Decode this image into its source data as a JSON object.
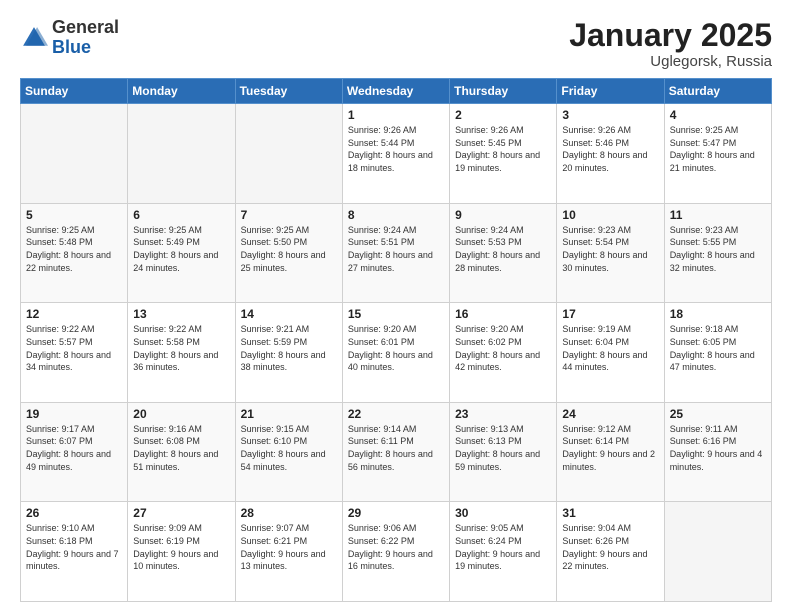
{
  "logo": {
    "general": "General",
    "blue": "Blue"
  },
  "header": {
    "title": "January 2025",
    "subtitle": "Uglegorsk, Russia"
  },
  "weekdays": [
    "Sunday",
    "Monday",
    "Tuesday",
    "Wednesday",
    "Thursday",
    "Friday",
    "Saturday"
  ],
  "weeks": [
    [
      {
        "day": "",
        "detail": ""
      },
      {
        "day": "",
        "detail": ""
      },
      {
        "day": "",
        "detail": ""
      },
      {
        "day": "1",
        "detail": "Sunrise: 9:26 AM\nSunset: 5:44 PM\nDaylight: 8 hours\nand 18 minutes."
      },
      {
        "day": "2",
        "detail": "Sunrise: 9:26 AM\nSunset: 5:45 PM\nDaylight: 8 hours\nand 19 minutes."
      },
      {
        "day": "3",
        "detail": "Sunrise: 9:26 AM\nSunset: 5:46 PM\nDaylight: 8 hours\nand 20 minutes."
      },
      {
        "day": "4",
        "detail": "Sunrise: 9:25 AM\nSunset: 5:47 PM\nDaylight: 8 hours\nand 21 minutes."
      }
    ],
    [
      {
        "day": "5",
        "detail": "Sunrise: 9:25 AM\nSunset: 5:48 PM\nDaylight: 8 hours\nand 22 minutes."
      },
      {
        "day": "6",
        "detail": "Sunrise: 9:25 AM\nSunset: 5:49 PM\nDaylight: 8 hours\nand 24 minutes."
      },
      {
        "day": "7",
        "detail": "Sunrise: 9:25 AM\nSunset: 5:50 PM\nDaylight: 8 hours\nand 25 minutes."
      },
      {
        "day": "8",
        "detail": "Sunrise: 9:24 AM\nSunset: 5:51 PM\nDaylight: 8 hours\nand 27 minutes."
      },
      {
        "day": "9",
        "detail": "Sunrise: 9:24 AM\nSunset: 5:53 PM\nDaylight: 8 hours\nand 28 minutes."
      },
      {
        "day": "10",
        "detail": "Sunrise: 9:23 AM\nSunset: 5:54 PM\nDaylight: 8 hours\nand 30 minutes."
      },
      {
        "day": "11",
        "detail": "Sunrise: 9:23 AM\nSunset: 5:55 PM\nDaylight: 8 hours\nand 32 minutes."
      }
    ],
    [
      {
        "day": "12",
        "detail": "Sunrise: 9:22 AM\nSunset: 5:57 PM\nDaylight: 8 hours\nand 34 minutes."
      },
      {
        "day": "13",
        "detail": "Sunrise: 9:22 AM\nSunset: 5:58 PM\nDaylight: 8 hours\nand 36 minutes."
      },
      {
        "day": "14",
        "detail": "Sunrise: 9:21 AM\nSunset: 5:59 PM\nDaylight: 8 hours\nand 38 minutes."
      },
      {
        "day": "15",
        "detail": "Sunrise: 9:20 AM\nSunset: 6:01 PM\nDaylight: 8 hours\nand 40 minutes."
      },
      {
        "day": "16",
        "detail": "Sunrise: 9:20 AM\nSunset: 6:02 PM\nDaylight: 8 hours\nand 42 minutes."
      },
      {
        "day": "17",
        "detail": "Sunrise: 9:19 AM\nSunset: 6:04 PM\nDaylight: 8 hours\nand 44 minutes."
      },
      {
        "day": "18",
        "detail": "Sunrise: 9:18 AM\nSunset: 6:05 PM\nDaylight: 8 hours\nand 47 minutes."
      }
    ],
    [
      {
        "day": "19",
        "detail": "Sunrise: 9:17 AM\nSunset: 6:07 PM\nDaylight: 8 hours\nand 49 minutes."
      },
      {
        "day": "20",
        "detail": "Sunrise: 9:16 AM\nSunset: 6:08 PM\nDaylight: 8 hours\nand 51 minutes."
      },
      {
        "day": "21",
        "detail": "Sunrise: 9:15 AM\nSunset: 6:10 PM\nDaylight: 8 hours\nand 54 minutes."
      },
      {
        "day": "22",
        "detail": "Sunrise: 9:14 AM\nSunset: 6:11 PM\nDaylight: 8 hours\nand 56 minutes."
      },
      {
        "day": "23",
        "detail": "Sunrise: 9:13 AM\nSunset: 6:13 PM\nDaylight: 8 hours\nand 59 minutes."
      },
      {
        "day": "24",
        "detail": "Sunrise: 9:12 AM\nSunset: 6:14 PM\nDaylight: 9 hours\nand 2 minutes."
      },
      {
        "day": "25",
        "detail": "Sunrise: 9:11 AM\nSunset: 6:16 PM\nDaylight: 9 hours\nand 4 minutes."
      }
    ],
    [
      {
        "day": "26",
        "detail": "Sunrise: 9:10 AM\nSunset: 6:18 PM\nDaylight: 9 hours\nand 7 minutes."
      },
      {
        "day": "27",
        "detail": "Sunrise: 9:09 AM\nSunset: 6:19 PM\nDaylight: 9 hours\nand 10 minutes."
      },
      {
        "day": "28",
        "detail": "Sunrise: 9:07 AM\nSunset: 6:21 PM\nDaylight: 9 hours\nand 13 minutes."
      },
      {
        "day": "29",
        "detail": "Sunrise: 9:06 AM\nSunset: 6:22 PM\nDaylight: 9 hours\nand 16 minutes."
      },
      {
        "day": "30",
        "detail": "Sunrise: 9:05 AM\nSunset: 6:24 PM\nDaylight: 9 hours\nand 19 minutes."
      },
      {
        "day": "31",
        "detail": "Sunrise: 9:04 AM\nSunset: 6:26 PM\nDaylight: 9 hours\nand 22 minutes."
      },
      {
        "day": "",
        "detail": ""
      }
    ]
  ]
}
